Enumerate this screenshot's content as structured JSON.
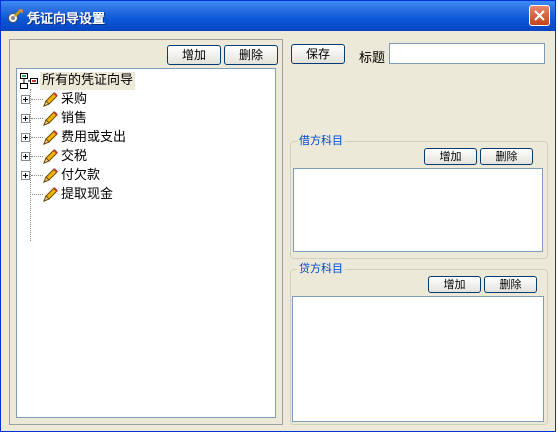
{
  "window": {
    "title": "凭证向导设置",
    "close_icon": "close-x-icon"
  },
  "left": {
    "add_label": "增加",
    "delete_label": "删除",
    "tree": {
      "root_label": "所有的凭证向导",
      "items": [
        {
          "label": "采购",
          "expandable": true
        },
        {
          "label": "销售",
          "expandable": true
        },
        {
          "label": "费用或支出",
          "expandable": true
        },
        {
          "label": "交税",
          "expandable": true
        },
        {
          "label": "付欠款",
          "expandable": true
        },
        {
          "label": "提取现金",
          "expandable": false
        }
      ]
    }
  },
  "right": {
    "save_label": "保存",
    "title_label": "标题",
    "title_value": "",
    "debit": {
      "legend": "借方科目",
      "add_label": "增加",
      "delete_label": "删除"
    },
    "credit": {
      "legend": "贷方科目",
      "add_label": "增加",
      "delete_label": "删除"
    }
  },
  "colors": {
    "titlebar": "#0a58d8",
    "window_bg": "#ece9d8",
    "legend_text": "#0046d5"
  }
}
